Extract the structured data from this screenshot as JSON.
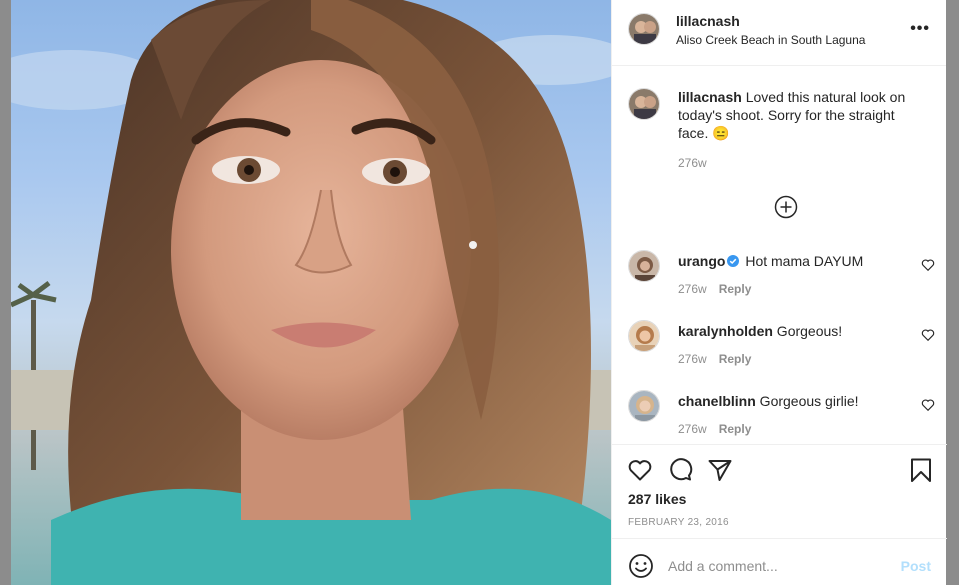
{
  "header": {
    "username": "lillacnash",
    "location": "Aliso Creek Beach in South Laguna",
    "more_label": "•••"
  },
  "caption": {
    "username": "lillacnash",
    "text": " Loved this natural look on today's shoot. Sorry for the straight face. 😑",
    "time": "276w"
  },
  "comments": [
    {
      "username": "urango",
      "verified": true,
      "text": " Hot mama DAYUM",
      "time": "276w",
      "reply": "Reply"
    },
    {
      "username": "karalynholden",
      "verified": false,
      "text": " Gorgeous!",
      "time": "276w",
      "reply": "Reply"
    },
    {
      "username": "chanelblinn",
      "verified": false,
      "text": " Gorgeous girlie!",
      "time": "276w",
      "reply": "Reply"
    }
  ],
  "actions": {
    "likes": "287 likes",
    "date": "FEBRUARY 23, 2016"
  },
  "add_comment": {
    "placeholder": "Add a comment...",
    "post_label": "Post"
  },
  "colors": {
    "verified": "#3897f0",
    "post_disabled": "#b2dffc",
    "secondary_text": "#8e8e8e"
  }
}
